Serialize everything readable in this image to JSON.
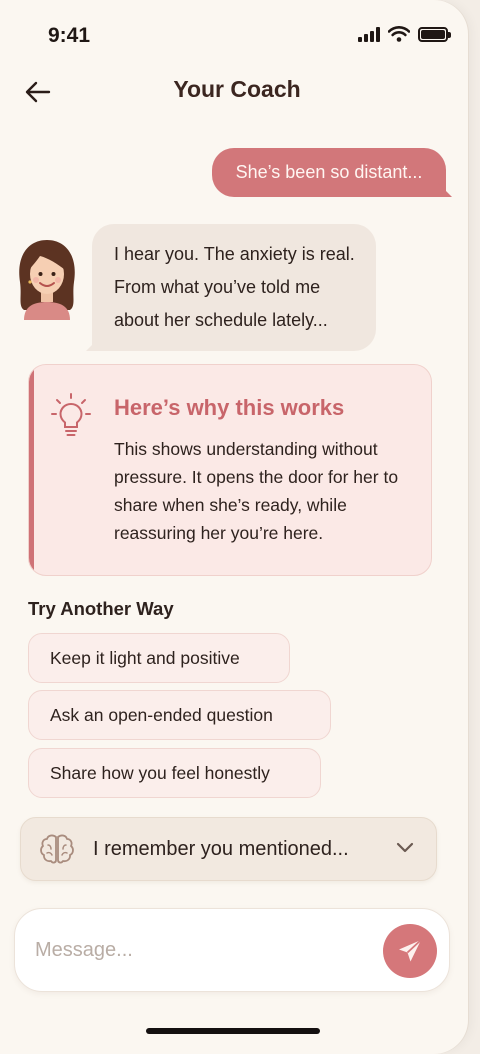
{
  "status_bar": {
    "time": "9:41"
  },
  "header": {
    "title": "Your Coach"
  },
  "messages": {
    "user": "She’s been so distant...",
    "coach_lines": [
      "I hear you. The anxiety is real.",
      "From what you’ve told me",
      "about her schedule lately..."
    ]
  },
  "insight": {
    "title": "Here’s why this works",
    "body": "This shows understanding without pressure. It opens the door for her to share when she’s ready, while reassuring her you’re here."
  },
  "alternatives": {
    "title": "Try Another Way",
    "options": [
      "Keep it light and positive",
      "Ask an open-ended question",
      "Share how you feel honestly"
    ]
  },
  "memory": {
    "label": "I remember you mentioned..."
  },
  "composer": {
    "placeholder": "Message..."
  },
  "colors": {
    "accent": "#d2777a",
    "background": "#fbf7f1",
    "coach_bubble": "#f0e7df",
    "insight_bg": "#fbe9e6"
  },
  "icons": [
    "back-arrow-icon",
    "lightbulb-icon",
    "brain-icon",
    "chevron-down-icon",
    "send-icon"
  ]
}
